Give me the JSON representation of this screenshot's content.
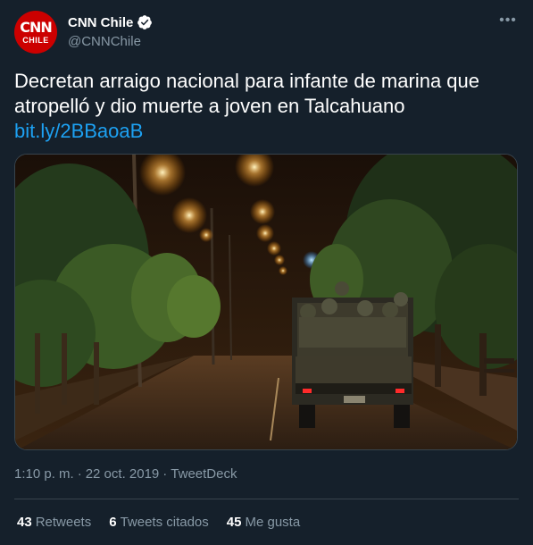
{
  "author": {
    "display_name": "CNN Chile",
    "handle": "@CNNChile",
    "logo_top": "CNN",
    "logo_bottom": "CHILE",
    "verified_icon": "verified-badge-icon"
  },
  "tweet": {
    "text": "Decretan arraigo nacional para infante de marina que atropelló y dio muerte a joven en Talcahuano",
    "link_text": "bit.ly/2BBaoaB",
    "time": "1:10 p. m.",
    "date": "22 oct. 2019",
    "source": "TweetDeck",
    "separator": "·",
    "more_icon": "more-options-icon",
    "media_icon": "photo-night-street-truck"
  },
  "stats": {
    "retweets_count": "43",
    "retweets_label": "Retweets",
    "quotes_count": "6",
    "quotes_label": "Tweets citados",
    "likes_count": "45",
    "likes_label": "Me gusta"
  },
  "colors": {
    "background": "#15202b",
    "text": "#ffffff",
    "secondary": "#8899a6",
    "link": "#1da1f2",
    "border": "#38444d",
    "brand": "#cc0000"
  }
}
